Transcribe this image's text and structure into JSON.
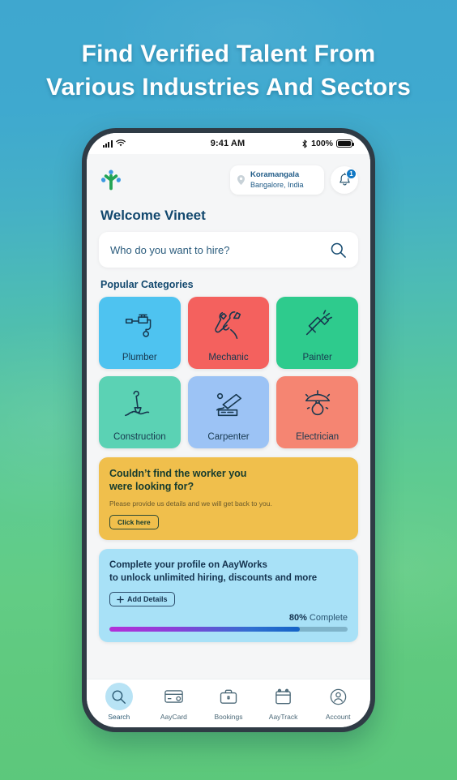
{
  "headline": {
    "line1": "Find Verified Talent From",
    "line2": "Various Industries And Sectors"
  },
  "colors": {
    "bg_top": "#3fa7cf",
    "bg_bottom": "#5cc87b",
    "accent_blue": "#1178c4",
    "heading_navy": "#12486e",
    "promo_yellow": "#f0bf4c",
    "profile_blue": "#a8e1f7"
  },
  "status_bar": {
    "signal_icon": "cellular-signal-icon",
    "wifi_icon": "wifi-icon",
    "time": "9:41 AM",
    "bluetooth_icon": "bluetooth-icon",
    "battery_percent": "100%",
    "battery_icon": "battery-full-icon"
  },
  "header": {
    "logo_icon": "aayworks-logo-icon",
    "location": {
      "pin_icon": "location-pin-icon",
      "area": "Koramangala",
      "city": "Bangalore, India"
    },
    "notification": {
      "bell_icon": "bell-icon",
      "badge_count": "1"
    }
  },
  "welcome": "Welcome Vineet",
  "search": {
    "placeholder": "Who do you want to hire?",
    "icon": "search-icon"
  },
  "categories_section": {
    "title": "Popular Categories",
    "items": [
      {
        "label": "Plumber",
        "color": "#4ec3f0",
        "icon": "faucet-icon"
      },
      {
        "label": "Mechanic",
        "color": "#f4615e",
        "icon": "wrench-spanner-icon"
      },
      {
        "label": "Painter",
        "color": "#2ecb8d",
        "icon": "paint-brush-icon"
      },
      {
        "label": "Construction",
        "color": "#5bd2b4",
        "icon": "shovel-icon"
      },
      {
        "label": "Carpenter",
        "color": "#9cc3f5",
        "icon": "chisel-icon"
      },
      {
        "label": "Electrician",
        "color": "#f58572",
        "icon": "ceiling-lamp-icon"
      }
    ]
  },
  "promo_card": {
    "title_line1": "Couldn’t find the worker you",
    "title_line2": "were looking for?",
    "subtitle": "Please provide us details and we will get back to you.",
    "button_label": "Click here"
  },
  "profile_card": {
    "title_line1": "Complete your profile on AayWorks",
    "title_line2": "to unlock unlimited hiring, discounts and more",
    "button_label": "Add Details",
    "button_icon": "plus-icon",
    "progress_percent": "80%",
    "progress_suffix": " Complete",
    "progress_value": 80
  },
  "bottom_nav": {
    "items": [
      {
        "label": "Search",
        "icon": "search-icon",
        "active": true
      },
      {
        "label": "AayCard",
        "icon": "credit-card-icon",
        "active": false
      },
      {
        "label": "Bookings",
        "icon": "briefcase-icon",
        "active": false
      },
      {
        "label": "AayTrack",
        "icon": "calendar-icon",
        "active": false
      },
      {
        "label": "Account",
        "icon": "user-circle-icon",
        "active": false
      }
    ]
  }
}
